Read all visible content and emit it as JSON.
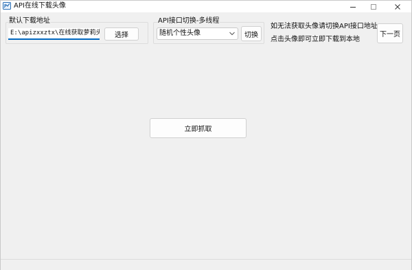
{
  "window": {
    "title": "API在线下载头像"
  },
  "download_group": {
    "label": "默认下载地址",
    "path_value": "E:\\apizxxztx\\在线获取萝莉头像",
    "select_button": "选择"
  },
  "api_group": {
    "label": "API接口切换-多线程",
    "selected_api": "随机个性头像",
    "switch_button": "切换"
  },
  "info": {
    "line1": "如无法获取头像请切换API接口地址",
    "line2": "点击头像即可立即下载到本地",
    "next_page_button": "下一页"
  },
  "main": {
    "fetch_button": "立即抓取"
  },
  "colors": {
    "accent": "#0067c0",
    "window_bg": "#f0f0f0",
    "button_bg": "#fdfdfd",
    "border": "#d0d0d0"
  }
}
